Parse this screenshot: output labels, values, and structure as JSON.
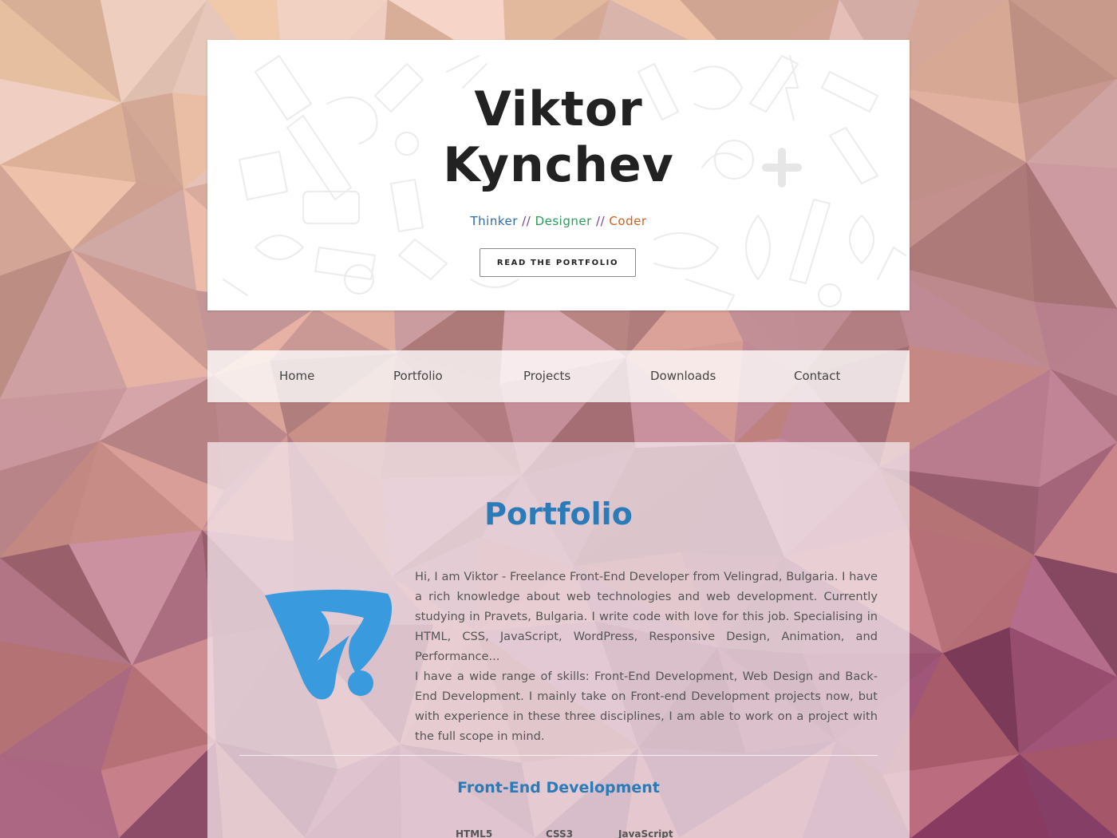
{
  "header": {
    "first_name": "Viktor",
    "last_name": "Kynchev",
    "tagline": {
      "thinker": "Thinker",
      "designer": "Designer",
      "coder": "Coder",
      "separator": "//"
    },
    "cta_label": "READ THE PORTFOLIO"
  },
  "nav": {
    "items": [
      {
        "label": "Home"
      },
      {
        "label": "Portfolio"
      },
      {
        "label": "Projects"
      },
      {
        "label": "Downloads"
      },
      {
        "label": "Contact"
      }
    ]
  },
  "portfolio": {
    "title": "Portfolio",
    "bio_paragraph_1": "Hi, I am Viktor - Freelance Front-End Developer from Velingrad, Bulgaria. I have a rich knowledge about web technologies and web development. Currently studying in Pravets, Bulgaria. I write code with love for this job. Specialising in HTML, CSS, JavaScript, WordPress, Responsive Design, Animation, and Performance...",
    "bio_paragraph_2": "I have a wide range of skills: Front-End Development, Web Design and Back-End Development. I mainly take on Front-end Development projects now, but with experience in these three disciplines, I am able to work on a project with the full scope in mind.",
    "section_title": "Front-End Development",
    "skills": [
      {
        "label": "HTML5"
      },
      {
        "label": "CSS3"
      },
      {
        "label": "JavaScript"
      }
    ]
  },
  "colors": {
    "accent_blue": "#2b7bb9",
    "logo_blue": "#3a9ade",
    "thinker": "#2f6aa8",
    "designer": "#2e9a5a",
    "coder": "#d2601d",
    "separator": "#7b3f9a"
  },
  "icons": {
    "logo": "v-logo-icon"
  }
}
